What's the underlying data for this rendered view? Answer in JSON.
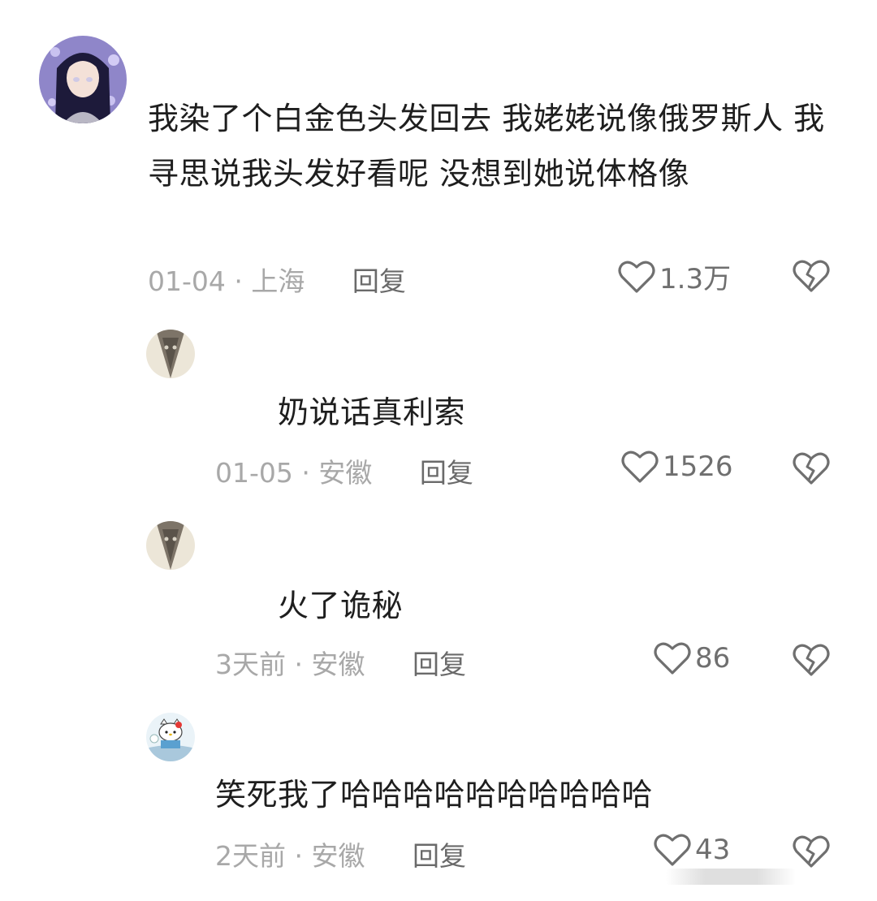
{
  "comments": [
    {
      "text": "我染了个白金色头发回去 我姥姥说像俄罗斯人 我寻思说我头发好看呢 没想到她说体格像",
      "date": "01-04",
      "location": "上海",
      "reply_label": "回复",
      "likes": "1.3万",
      "avatar_icon": "anime-girl-avatar"
    },
    {
      "text": "奶说话真利索",
      "date": "01-05",
      "location": "安徽",
      "reply_label": "回复",
      "likes": "1526",
      "avatar_icon": "cat-avatar"
    },
    {
      "text": "火了诡秘",
      "date": "3天前",
      "location": "安徽",
      "reply_label": "回复",
      "likes": "86",
      "avatar_icon": "cat-avatar"
    },
    {
      "text": "笑死我了哈哈哈哈哈哈哈哈哈哈",
      "date": "2天前",
      "location": "安徽",
      "reply_label": "回复",
      "likes": "43",
      "avatar_icon": "hello-kitty-avatar"
    }
  ],
  "separator": " · ",
  "colors": {
    "text": "#1e1e1e",
    "meta": "#a8a8a8",
    "reply": "#6a6a6a",
    "icon": "#6f6f6f"
  }
}
